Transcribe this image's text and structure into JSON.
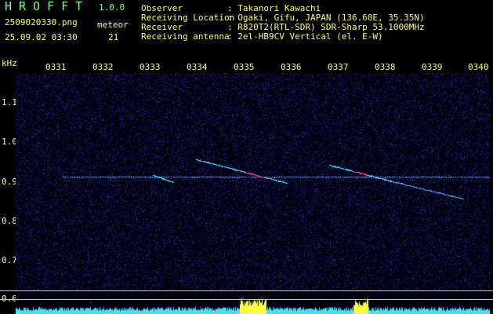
{
  "app": {
    "title": "HROFFT",
    "version": "1.0.0"
  },
  "file": {
    "name": "2509020330.png",
    "datetime": "25.09.02 03:30"
  },
  "meteor": {
    "label": "meteor",
    "count": "21"
  },
  "info": [
    {
      "key": "Observer",
      "value": ": Takanori Kawachi"
    },
    {
      "key": "Receiving Location",
      "value": ": Ogaki, Gifu, JAPAN (136.60E, 35.35N)"
    },
    {
      "key": "Receiver",
      "value": ": R820T2(RTL-SDR) SDR-Sharp 53.1000MHz"
    },
    {
      "key": "Receiving antenna",
      "value": ": 2el-HB9CV Vertical (el. E-W)"
    }
  ],
  "axes": {
    "y_unit": "kHz",
    "y_ticks": [
      "1.1",
      "1.0",
      "0.9",
      "0.8",
      "0.7",
      "0.6"
    ],
    "x_ticks": [
      "0331",
      "0332",
      "0333",
      "0334",
      "0335",
      "0336",
      "0337",
      "0338",
      "0339",
      "0340"
    ]
  },
  "colors": {
    "label": "#ffff66",
    "title": "#7cff7c",
    "carrier": "#3a7cff",
    "echo": "#3fe0ff",
    "echo_core": "#ff3fa0",
    "noise": "#101860"
  }
}
